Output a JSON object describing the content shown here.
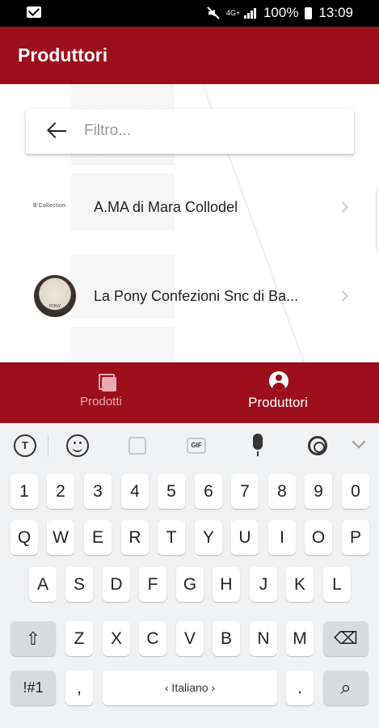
{
  "status_bar": {
    "network": "4G+",
    "battery": "100%",
    "time": "13:09",
    "icons": [
      "mail-icon",
      "mute-icon",
      "signal-icon",
      "battery-icon"
    ]
  },
  "app_bar": {
    "title": "Produttori"
  },
  "search": {
    "placeholder": "Filtro...",
    "value": ""
  },
  "producers": [
    {
      "name": "A.MA di Mara Collodel",
      "logo_text": "B'Collection"
    },
    {
      "name": "La Pony Confezioni Snc di Ba...",
      "logo_text": "PONY"
    }
  ],
  "bottom_nav": [
    {
      "label": "Prodotti",
      "active": false
    },
    {
      "label": "Produttori",
      "active": true
    }
  ],
  "keyboard": {
    "row_numbers": [
      "1",
      "2",
      "3",
      "4",
      "5",
      "6",
      "7",
      "8",
      "9",
      "0"
    ],
    "row_1": [
      "Q",
      "W",
      "E",
      "R",
      "T",
      "Y",
      "U",
      "I",
      "O",
      "P"
    ],
    "row_2": [
      "A",
      "S",
      "D",
      "F",
      "G",
      "H",
      "J",
      "K",
      "L"
    ],
    "row_3": [
      "Z",
      "X",
      "C",
      "V",
      "B",
      "N",
      "M"
    ],
    "symbols_label": "!#1",
    "comma": ",",
    "period": ".",
    "space_label": "‹ Italiano ›",
    "shift_glyph": "⇧",
    "backspace_glyph": "⌫",
    "search_glyph": "⌕",
    "toolbar_gif_label": "GIF",
    "toolbar_t_label": "T"
  },
  "colors": {
    "brand": "#9e0f1c",
    "nav_inactive": "#e8a9af",
    "keyboard_bg": "#f0f1f3"
  }
}
